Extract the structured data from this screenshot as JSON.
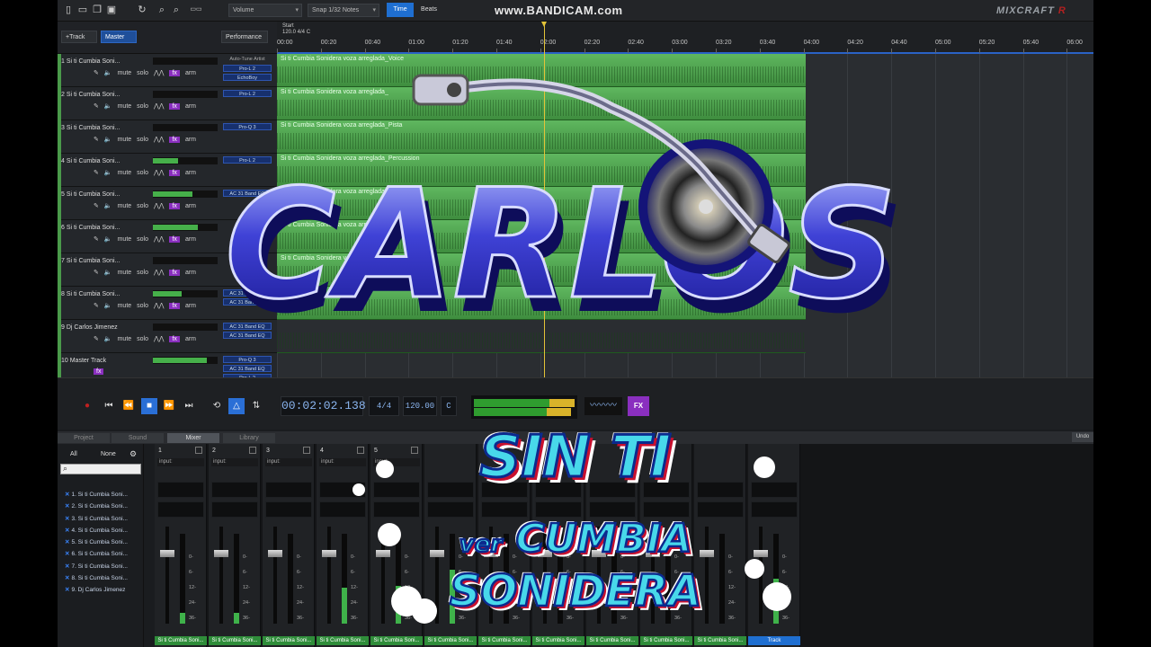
{
  "watermark": "www.BANDICAM.com",
  "brand": {
    "name": "MIXCRAFT",
    "suffix": "R"
  },
  "toolbar": {
    "volume_select": "Volume",
    "snap_select": "Snap 1/32 Notes",
    "time_button": "Time",
    "beats_button": "Beats"
  },
  "track_header": {
    "add_track": "+Track",
    "master": "Master",
    "performance": "Performance"
  },
  "ruler": {
    "start_label": "Start",
    "tempo_sig": "120.0 4/4 C",
    "ticks": [
      "00:00",
      "00:20",
      "00:40",
      "01:00",
      "01:20",
      "01:40",
      "02:00",
      "02:20",
      "02:40",
      "03:00",
      "03:20",
      "03:40",
      "04:00",
      "04:20",
      "04:40",
      "05:00",
      "05:20",
      "05:40",
      "06:00"
    ]
  },
  "track_controls": {
    "mute": "mute",
    "solo": "solo",
    "fx": "fx",
    "arm": "arm"
  },
  "tracks": [
    {
      "name": "1 Si ti Cumbia Soni...",
      "plugins": [
        "Auto-Tune Artist",
        "Pro-L 2",
        "EchoBoy"
      ],
      "clip": "Si ti Cumbia Sonidera voza arreglada_Voice"
    },
    {
      "name": "2 Si ti Cumbia Soni...",
      "plugins": [
        "Pro-L 2"
      ],
      "clip": "Si ti Cumbia Sonidera voza arreglada_"
    },
    {
      "name": "3 Si ti Cumbia Soni...",
      "plugins": [
        "Pro-Q 3"
      ],
      "clip": "Si ti Cumbia Sonidera voza arreglada_Pista"
    },
    {
      "name": "4 Si ti Cumbia Soni...",
      "plugins": [
        "Pro-L 2"
      ],
      "clip": "Si ti Cumbia Sonidera voza arreglada_Percussion"
    },
    {
      "name": "5 Si ti Cumbia Soni...",
      "plugins": [
        "AC 31 Band EQ"
      ],
      "clip": "Si ti Cumbia Sonidera voza arreglada_"
    },
    {
      "name": "6 Si ti Cumbia Soni...",
      "plugins": [],
      "clip": "Si ti Cumbia Sonidera voza arreglada_"
    },
    {
      "name": "7 Si ti Cumbia Soni...",
      "plugins": [],
      "clip": "Si ti Cumbia Sonidera voza arreglada_"
    },
    {
      "name": "8 Si ti Cumbia Soni...",
      "plugins": [
        "AC 31 Band EQ",
        "AC 31 Band EQ"
      ],
      "clip": ""
    },
    {
      "name": "9 Dj Carlos Jimenez",
      "plugins": [
        "AC 31 Band EQ",
        "AC 31 Band EQ"
      ],
      "clip": ""
    },
    {
      "name": "10 Master Track",
      "plugins": [
        "Pro-Q 3",
        "AC 31 Band EQ",
        "Pro-L 2"
      ],
      "clip": ""
    }
  ],
  "transport": {
    "time": "00:02:02.138",
    "signature": "4/4",
    "tempo": "120.00",
    "key": "C",
    "fx": "FX"
  },
  "tabs": [
    "Project",
    "Sound",
    "Mixer",
    "Library"
  ],
  "active_tab": "Mixer",
  "undo": "Undo",
  "mixer": {
    "filter_all": "All",
    "filter_none": "None",
    "track_list": [
      "1. Si ti Cumbia Soni...",
      "2. Si ti Cumbia Soni...",
      "3. Si ti Cumbia Soni...",
      "4. Si ti Cumbia Soni...",
      "5. Si ti Cumbia Soni...",
      "6. Si ti Cumbia Soni...",
      "7. Si ti Cumbia Soni...",
      "8. Si ti Cumbia Soni...",
      "9. Dj Carlos Jimenez"
    ],
    "strip_numbers": [
      "1",
      "2",
      "3",
      "4",
      "5"
    ],
    "input_label": "input:",
    "strip_label": "Si ti Cumbia Soni...",
    "master_label": "Track",
    "scale": [
      "0-",
      "6-",
      "12-",
      "24-",
      "36-"
    ]
  },
  "overlay": {
    "logo_text": "CARLOS",
    "promo_line1": "SIN TI",
    "promo_line2_small": "ver",
    "promo_line2": "CUMBIA",
    "promo_line3": "SONIDERA"
  }
}
